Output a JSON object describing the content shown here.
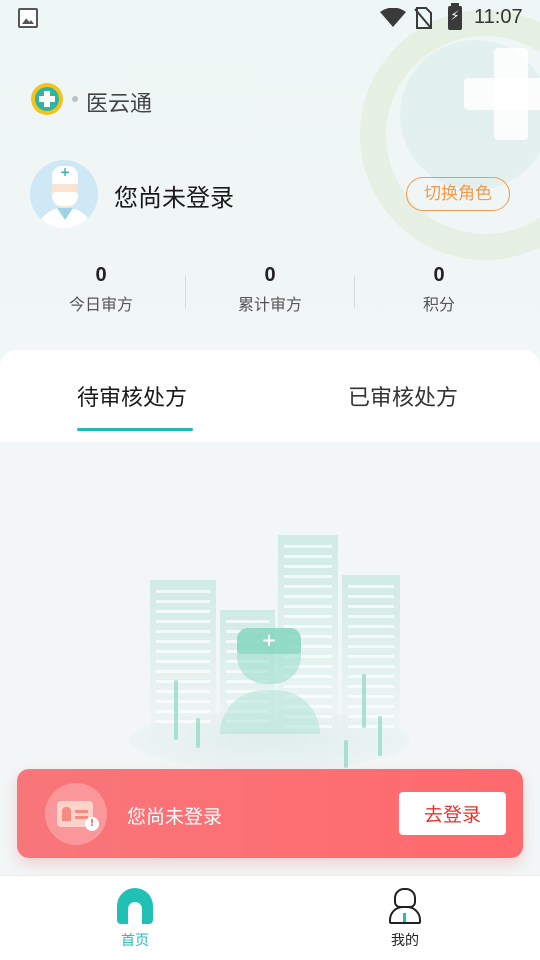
{
  "status_bar": {
    "time": "11:07",
    "icons": [
      "image-icon",
      "wifi-icon",
      "no-sim-icon",
      "battery-charging-icon"
    ]
  },
  "header": {
    "app_name": "医云通",
    "logo_icon": "medical-cross-logo-icon"
  },
  "profile": {
    "avatar_icon": "doctor-avatar-icon",
    "login_status": "您尚未登录",
    "switch_role_label": "切换角色"
  },
  "stats": [
    {
      "value": "0",
      "label": "今日审方"
    },
    {
      "value": "0",
      "label": "累计审方"
    },
    {
      "value": "0",
      "label": "积分"
    }
  ],
  "tabs": [
    {
      "label": "待审核处方",
      "active": true
    },
    {
      "label": "已审核处方",
      "active": false
    }
  ],
  "empty_state": {
    "illustration_icon": "hospital-nurse-illustration"
  },
  "login_banner": {
    "text": "您尚未登录",
    "button_label": "去登录",
    "icon": "id-card-icon"
  },
  "bottom_nav": [
    {
      "label": "首页",
      "icon": "home-icon",
      "active": true
    },
    {
      "label": "我的",
      "icon": "user-icon",
      "active": false
    }
  ],
  "colors": {
    "accent": "#20c0b4",
    "orange": "#f39a4a",
    "banner_red": "#ff6a6d",
    "button_text_red": "#e5322d"
  }
}
